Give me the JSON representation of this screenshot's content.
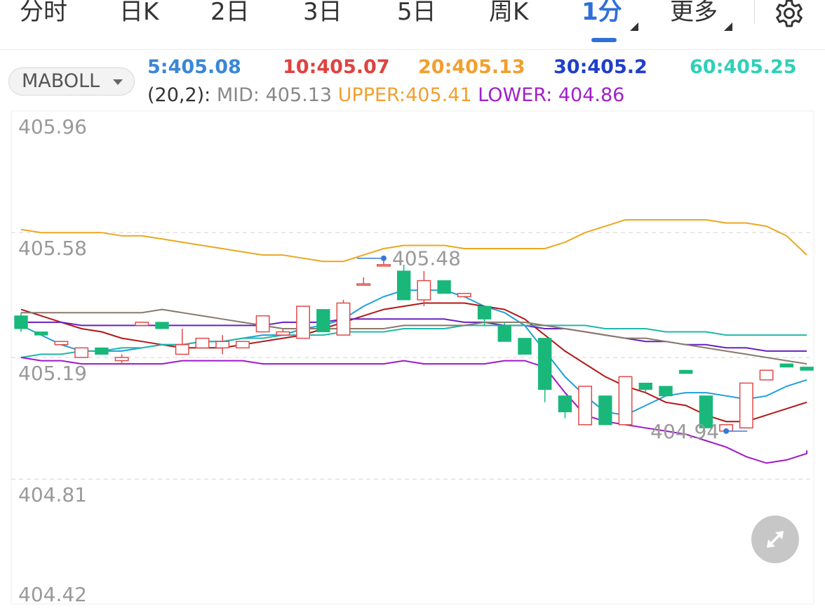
{
  "tabs": {
    "items": [
      {
        "label": "分时"
      },
      {
        "label": "日K"
      },
      {
        "label": "2日"
      },
      {
        "label": "3日"
      },
      {
        "label": "5日"
      },
      {
        "label": "周K"
      },
      {
        "label": "1分",
        "active": true
      },
      {
        "label": "更多"
      }
    ],
    "settings_icon": "gear-icon"
  },
  "indicator": {
    "selector_label": "MABOLL",
    "ma": [
      {
        "label": "5:405.08",
        "color": "#3a86d8"
      },
      {
        "label": "10:405.07",
        "color": "#e0423f"
      },
      {
        "label": "20:405.13",
        "color": "#f0a030"
      },
      {
        "label": "30:405.2",
        "color": "#1f3fc8"
      },
      {
        "label": "60:405.25",
        "color": "#2fd0b8"
      }
    ],
    "boll": {
      "prefix": "(20,2):",
      "mid": "MID: 405.13",
      "upper": "UPPER:405.41",
      "lower": "LOWER: 404.86"
    }
  },
  "expand_icon": "expand-arrows-icon",
  "chart_data": {
    "type": "candlestick",
    "y_axis_labels": [
      "405.96",
      "405.58",
      "405.19",
      "404.81",
      "404.42"
    ],
    "ylim": [
      404.42,
      405.96
    ],
    "grid": true,
    "high_marker": "405.48",
    "low_marker": "404.94",
    "colors": {
      "up": "#e04a4a",
      "down": "#19b87a"
    },
    "candles": [
      {
        "o": 405.32,
        "h": 405.33,
        "c": 405.28,
        "l": 405.27
      },
      {
        "o": 405.27,
        "h": 405.27,
        "c": 405.26,
        "l": 405.26
      },
      {
        "o": 405.23,
        "h": 405.23,
        "c": 405.24,
        "l": 405.24
      },
      {
        "o": 405.19,
        "h": 405.22,
        "c": 405.22,
        "l": 405.19
      },
      {
        "o": 405.22,
        "h": 405.22,
        "c": 405.2,
        "l": 405.2
      },
      {
        "o": 405.18,
        "h": 405.2,
        "c": 405.19,
        "l": 405.17
      },
      {
        "o": 405.29,
        "h": 405.29,
        "c": 405.3,
        "l": 405.3
      },
      {
        "o": 405.3,
        "h": 405.3,
        "c": 405.28,
        "l": 405.28
      },
      {
        "o": 405.2,
        "h": 405.28,
        "c": 405.23,
        "l": 405.2
      },
      {
        "o": 405.22,
        "h": 405.25,
        "c": 405.25,
        "l": 405.22
      },
      {
        "o": 405.22,
        "h": 405.26,
        "c": 405.24,
        "l": 405.2
      },
      {
        "o": 405.22,
        "h": 405.22,
        "c": 405.24,
        "l": 405.22
      },
      {
        "o": 405.27,
        "h": 405.32,
        "c": 405.32,
        "l": 405.27
      },
      {
        "o": 405.26,
        "h": 405.28,
        "c": 405.27,
        "l": 405.26
      },
      {
        "o": 405.25,
        "h": 405.35,
        "c": 405.35,
        "l": 405.25
      },
      {
        "o": 405.34,
        "h": 405.34,
        "c": 405.27,
        "l": 405.27
      },
      {
        "o": 405.26,
        "h": 405.37,
        "c": 405.36,
        "l": 405.26
      },
      {
        "o": 405.42,
        "h": 405.44,
        "c": 405.42,
        "l": 405.42
      },
      {
        "o": 405.48,
        "h": 405.5,
        "c": 405.48,
        "l": 405.48
      },
      {
        "o": 405.46,
        "h": 405.48,
        "c": 405.37,
        "l": 405.37
      },
      {
        "o": 405.37,
        "h": 405.46,
        "c": 405.43,
        "l": 405.35
      },
      {
        "o": 405.43,
        "h": 405.43,
        "c": 405.39,
        "l": 405.39
      },
      {
        "o": 405.38,
        "h": 405.39,
        "c": 405.39,
        "l": 405.38
      },
      {
        "o": 405.35,
        "h": 405.35,
        "c": 405.31,
        "l": 405.29
      },
      {
        "o": 405.29,
        "h": 405.3,
        "c": 405.24,
        "l": 405.24
      },
      {
        "o": 405.25,
        "h": 405.25,
        "c": 405.2,
        "l": 405.2
      },
      {
        "o": 405.25,
        "h": 405.25,
        "c": 405.09,
        "l": 405.05
      },
      {
        "o": 405.07,
        "h": 405.07,
        "c": 405.02,
        "l": 405.0
      },
      {
        "o": 404.98,
        "h": 405.1,
        "c": 405.1,
        "l": 404.98
      },
      {
        "o": 405.07,
        "h": 405.07,
        "c": 404.98,
        "l": 404.98
      },
      {
        "o": 404.98,
        "h": 405.13,
        "c": 405.13,
        "l": 404.98
      },
      {
        "o": 405.11,
        "h": 405.11,
        "c": 405.09,
        "l": 405.08
      },
      {
        "o": 405.1,
        "h": 405.1,
        "c": 405.07,
        "l": 405.07
      },
      {
        "o": 405.15,
        "h": 405.15,
        "c": 405.14,
        "l": 405.14
      },
      {
        "o": 405.07,
        "h": 405.07,
        "c": 404.97,
        "l": 404.97
      },
      {
        "o": 404.96,
        "h": 404.98,
        "c": 404.98,
        "l": 404.96
      },
      {
        "o": 404.97,
        "h": 405.11,
        "c": 405.11,
        "l": 404.97
      },
      {
        "o": 405.12,
        "h": 405.15,
        "c": 405.15,
        "l": 405.12
      },
      {
        "o": 405.17,
        "h": 405.17,
        "c": 405.16,
        "l": 405.16
      },
      {
        "o": 405.16,
        "h": 405.16,
        "c": 405.15,
        "l": 405.15
      }
    ],
    "series": [
      {
        "name": "MA5",
        "color": "#1f9fd8",
        "values": [
          405.29,
          405.26,
          405.23,
          405.21,
          405.21,
          405.21,
          405.22,
          405.23,
          405.23,
          405.24,
          405.24,
          405.25,
          405.26,
          405.26,
          405.28,
          405.29,
          405.31,
          405.35,
          405.38,
          405.4,
          405.4,
          405.4,
          405.38,
          405.35,
          405.33,
          405.29,
          405.21,
          405.13,
          405.07,
          405.02,
          405.01,
          405.04,
          405.07,
          405.08,
          405.08,
          405.07,
          405.06,
          405.07,
          405.1,
          405.12
        ]
      },
      {
        "name": "MA10",
        "color": "#b01818",
        "values": [
          405.34,
          405.32,
          405.3,
          405.28,
          405.27,
          405.25,
          405.24,
          405.23,
          405.22,
          405.22,
          405.22,
          405.23,
          405.24,
          405.25,
          405.26,
          405.28,
          405.3,
          405.32,
          405.34,
          405.35,
          405.36,
          405.36,
          405.36,
          405.35,
          405.34,
          405.31,
          405.26,
          405.21,
          405.17,
          405.13,
          405.1,
          405.08,
          405.05,
          405.04,
          405.01,
          404.99,
          404.99,
          405.01,
          405.03,
          405.05
        ]
      },
      {
        "name": "MA30",
        "color": "#6a20c0",
        "values": [
          405.3,
          405.3,
          405.3,
          405.29,
          405.29,
          405.29,
          405.29,
          405.29,
          405.29,
          405.29,
          405.29,
          405.29,
          405.29,
          405.3,
          405.3,
          405.3,
          405.31,
          405.31,
          405.31,
          405.31,
          405.31,
          405.31,
          405.3,
          405.3,
          405.29,
          405.29,
          405.28,
          405.28,
          405.27,
          405.26,
          405.25,
          405.24,
          405.24,
          405.23,
          405.23,
          405.22,
          405.22,
          405.21,
          405.21,
          405.21
        ]
      },
      {
        "name": "MA60",
        "color": "#20b8a8",
        "values": [
          405.19,
          405.2,
          405.2,
          405.21,
          405.21,
          405.22,
          405.22,
          405.23,
          405.23,
          405.24,
          405.24,
          405.25,
          405.25,
          405.26,
          405.26,
          405.26,
          405.27,
          405.27,
          405.27,
          405.28,
          405.28,
          405.28,
          405.29,
          405.29,
          405.29,
          405.29,
          405.29,
          405.29,
          405.29,
          405.28,
          405.28,
          405.28,
          405.27,
          405.27,
          405.27,
          405.26,
          405.26,
          405.26,
          405.26,
          405.26
        ]
      },
      {
        "name": "MID",
        "color": "#8a7a6a",
        "values": [
          405.33,
          405.33,
          405.33,
          405.33,
          405.33,
          405.33,
          405.33,
          405.34,
          405.33,
          405.32,
          405.31,
          405.3,
          405.29,
          405.28,
          405.28,
          405.28,
          405.28,
          405.28,
          405.28,
          405.29,
          405.29,
          405.29,
          405.29,
          405.3,
          405.3,
          405.3,
          405.29,
          405.28,
          405.27,
          405.26,
          405.25,
          405.25,
          405.24,
          405.23,
          405.22,
          405.21,
          405.2,
          405.19,
          405.18,
          405.17
        ]
      },
      {
        "name": "UPPER",
        "color": "#eaa820",
        "values": [
          405.59,
          405.58,
          405.58,
          405.58,
          405.58,
          405.57,
          405.57,
          405.56,
          405.55,
          405.54,
          405.53,
          405.52,
          405.51,
          405.51,
          405.5,
          405.49,
          405.49,
          405.51,
          405.53,
          405.54,
          405.54,
          405.54,
          405.53,
          405.53,
          405.53,
          405.53,
          405.53,
          405.55,
          405.58,
          405.6,
          405.62,
          405.62,
          405.62,
          405.62,
          405.62,
          405.61,
          405.61,
          405.6,
          405.57,
          405.51
        ]
      },
      {
        "name": "LOWER",
        "color": "#a018c8",
        "values": [
          405.19,
          405.18,
          405.18,
          405.17,
          405.17,
          405.17,
          405.17,
          405.17,
          405.18,
          405.18,
          405.18,
          405.18,
          405.17,
          405.17,
          405.17,
          405.17,
          405.17,
          405.17,
          405.17,
          405.18,
          405.17,
          405.17,
          405.17,
          405.17,
          405.18,
          405.18,
          405.16,
          405.08,
          405.01,
          404.99,
          404.98,
          404.97,
          404.96,
          404.95,
          404.93,
          404.91,
          404.88,
          404.86,
          404.87,
          404.89,
          404.9
        ]
      }
    ]
  }
}
